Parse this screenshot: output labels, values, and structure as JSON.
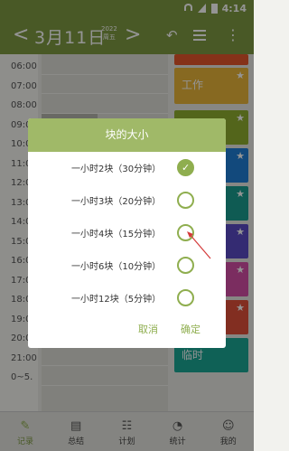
{
  "status_bar": {
    "time": "4:14"
  },
  "app_bar": {
    "prev": "<",
    "date": "3月11日",
    "year": "2022",
    "weekday": "周五",
    "next": ">",
    "undo": "↶",
    "more": "⋮"
  },
  "time_labels": [
    "06:00",
    "07:00",
    "08:00",
    "09:00",
    "10:00",
    "11:00",
    "12:00",
    "13:00",
    "14:00",
    "15:00",
    "16:00",
    "17:00",
    "18:00",
    "19:00",
    "20:00",
    "21:00",
    "0~5."
  ],
  "categories": [
    {
      "label": "",
      "color": "#e5572c"
    },
    {
      "label": "工作",
      "color": "#e8b53a"
    },
    {
      "label": "",
      "color": "#8fae2f"
    },
    {
      "label": "",
      "color": "#1f7fd6"
    },
    {
      "label": "",
      "color": "#1a9e8f"
    },
    {
      "label": "",
      "color": "#5b4bc4"
    },
    {
      "label": "",
      "color": "#d44fa6"
    },
    {
      "label": "",
      "color": "#e0503a"
    },
    {
      "label": "临时",
      "color": "#1aa894"
    }
  ],
  "add_button": "+",
  "tabs": [
    {
      "label": "记录",
      "active": true
    },
    {
      "label": "总结",
      "active": false
    },
    {
      "label": "计划",
      "active": false
    },
    {
      "label": "统计",
      "active": false
    },
    {
      "label": "我的",
      "active": false
    }
  ],
  "dialog": {
    "title": "块的大小",
    "options": [
      {
        "label": "一小时2块（30分钟）",
        "checked": true
      },
      {
        "label": "一小时3块（20分钟）",
        "checked": false
      },
      {
        "label": "一小时4块（15分钟）",
        "checked": false
      },
      {
        "label": "一小时6块（10分钟）",
        "checked": false
      },
      {
        "label": "一小时12块（5分钟）",
        "checked": false
      }
    ],
    "cancel": "取消",
    "confirm": "确定"
  },
  "colors": {
    "accent": "#8fae4f",
    "header": "#7f9a43",
    "dialog_header": "#a0b968"
  }
}
